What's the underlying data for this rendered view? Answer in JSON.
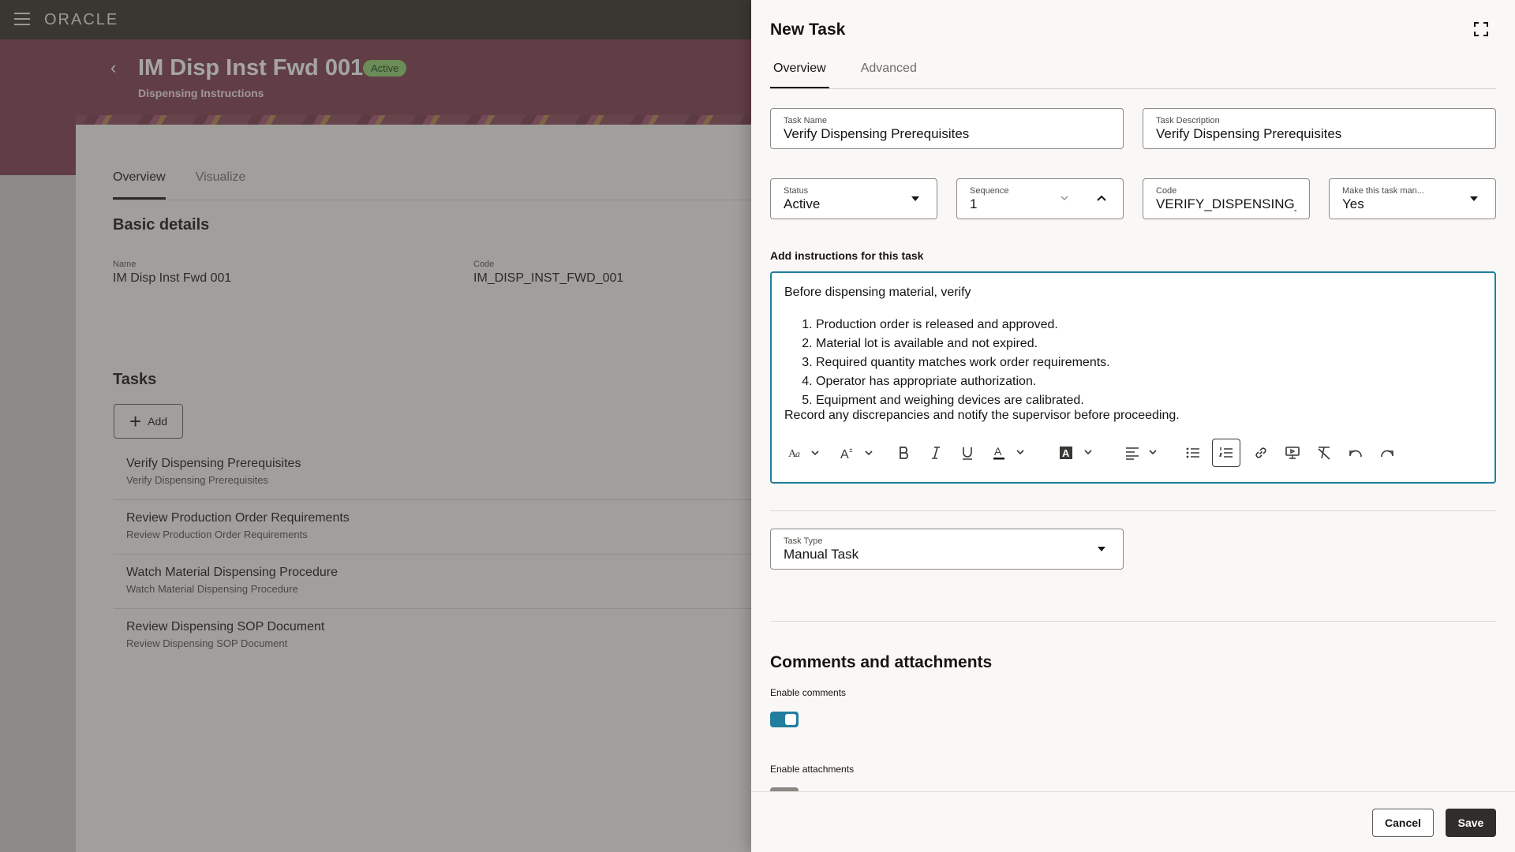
{
  "app": {
    "brand": "ORACLE"
  },
  "page": {
    "title": "IM Disp Inst Fwd 001",
    "status_badge": "Active",
    "subtitle": "Dispensing Instructions",
    "tabs": [
      "Overview",
      "Visualize"
    ],
    "basic_details": {
      "heading": "Basic details",
      "name_label": "Name",
      "name_value": "IM Disp Inst Fwd 001",
      "code_label": "Code",
      "code_value": "IM_DISP_INST_FWD_001"
    },
    "tasks": {
      "heading": "Tasks",
      "add_label": "Add",
      "items": [
        {
          "name": "Verify Dispensing Prerequisites",
          "description": "Verify Dispensing Prerequisites"
        },
        {
          "name": "Review Production Order Requirements",
          "description": "Review Production Order Requirements"
        },
        {
          "name": "Watch Material Dispensing Procedure",
          "description": "Watch Material Dispensing Procedure"
        },
        {
          "name": "Review Dispensing SOP Document",
          "description": "Review Dispensing SOP Document"
        }
      ]
    }
  },
  "drawer": {
    "title": "New Task",
    "tabs": [
      "Overview",
      "Advanced"
    ],
    "task_name": {
      "label": "Task Name",
      "value": "Verify Dispensing Prerequisites"
    },
    "task_description": {
      "label": "Task Description",
      "value": "Verify Dispensing Prerequisites"
    },
    "status": {
      "label": "Status",
      "value": "Active"
    },
    "sequence": {
      "label": "Sequence",
      "value": "1"
    },
    "code": {
      "label": "Code",
      "value": "VERIFY_DISPENSING_PR"
    },
    "mandatory": {
      "label": "Make this task man...",
      "value": "Yes"
    },
    "instructions": {
      "label": "Add instructions for this task",
      "intro": "Before dispensing material, verify",
      "steps": [
        "Production order is released and approved.",
        "Material lot is available and not expired.",
        "Required quantity matches work order requirements.",
        "Operator has appropriate authorization.",
        "Equipment and weighing devices are calibrated."
      ],
      "outro": "Record any discrepancies and notify the supervisor before proceeding."
    },
    "task_type": {
      "label": "Task Type",
      "value": "Manual Task"
    },
    "comments_section": {
      "heading": "Comments and attachments",
      "enable_comments_label": "Enable comments",
      "enable_comments": true,
      "enable_attachments_label": "Enable attachments",
      "enable_attachments": false
    },
    "buttons": {
      "cancel": "Cancel",
      "save": "Save"
    }
  },
  "colors": {
    "accent": "#227e9e",
    "banner": "#7b3a4e",
    "topbar": "#312d2a",
    "badge": "#8fd16f"
  }
}
